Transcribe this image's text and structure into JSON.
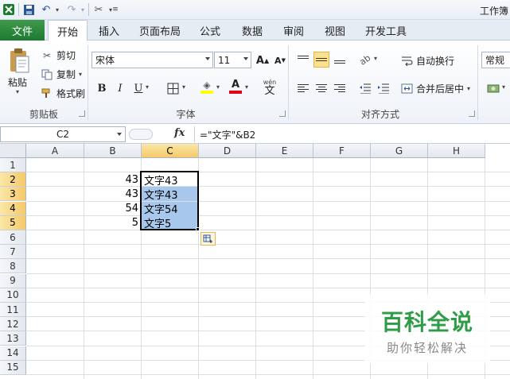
{
  "window": {
    "title": "工作簿"
  },
  "tabs": {
    "file": "文件",
    "items": [
      "开始",
      "插入",
      "页面布局",
      "公式",
      "数据",
      "审阅",
      "视图",
      "开发工具"
    ],
    "active_index": 0
  },
  "clipboard": {
    "paste": "粘贴",
    "cut": "剪切",
    "copy": "复制",
    "format_painter": "格式刷",
    "group_label": "剪贴板"
  },
  "font": {
    "name": "宋体",
    "size": "11",
    "bold": "B",
    "italic": "I",
    "underline": "U",
    "font_color_glyph": "A",
    "phonetic": "wén",
    "phonetic_char": "文",
    "grow_glyph": "A",
    "shrink_glyph": "A",
    "group_label": "字体"
  },
  "alignment": {
    "wrap_text": "自动换行",
    "merge_center": "合并后居中",
    "group_label": "对齐方式"
  },
  "number": {
    "format": "常规"
  },
  "formula_bar": {
    "name_box": "C2",
    "fx": "fx",
    "formula": "=\"文字\"&B2"
  },
  "sheet": {
    "columns": [
      "A",
      "B",
      "C",
      "D",
      "E",
      "F",
      "G",
      "H"
    ],
    "selected_column": "C",
    "rows": [
      "1",
      "2",
      "3",
      "4",
      "5",
      "6",
      "7",
      "8",
      "9",
      "10",
      "11",
      "12",
      "13",
      "14",
      "15"
    ],
    "selected_rows": [
      "2",
      "3",
      "4",
      "5"
    ],
    "cells": {
      "B2": "43",
      "B3": "43",
      "B4": "54",
      "B5": "5",
      "C2": "文字43",
      "C3": "文字43",
      "C4": "文字54",
      "C5": "文字5"
    },
    "selection_fill_color": "#a7c8ec"
  },
  "watermark": {
    "main": "百科全说",
    "sub": "助你轻松解决",
    "color": "#2f9d48"
  }
}
